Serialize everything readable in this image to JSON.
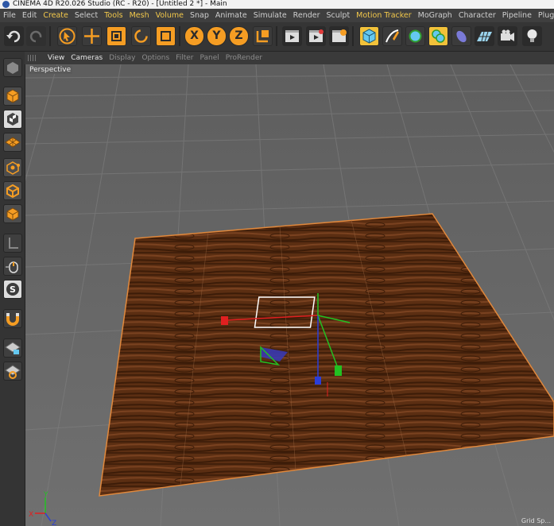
{
  "title_bar": {
    "text": "CINEMA 4D R20.026 Studio (RC - R20) - [Untitled 2 *] - Main"
  },
  "menu": {
    "items": [
      {
        "label": "File",
        "hl": false
      },
      {
        "label": "Edit",
        "hl": false
      },
      {
        "label": "Create",
        "hl": true
      },
      {
        "label": "Select",
        "hl": false
      },
      {
        "label": "Tools",
        "hl": true
      },
      {
        "label": "Mesh",
        "hl": true
      },
      {
        "label": "Volume",
        "hl": true
      },
      {
        "label": "Snap",
        "hl": false
      },
      {
        "label": "Animate",
        "hl": false
      },
      {
        "label": "Simulate",
        "hl": false
      },
      {
        "label": "Render",
        "hl": false
      },
      {
        "label": "Sculpt",
        "hl": false
      },
      {
        "label": "Motion Tracker",
        "hl": true
      },
      {
        "label": "MoGraph",
        "hl": false
      },
      {
        "label": "Character",
        "hl": false
      },
      {
        "label": "Pipeline",
        "hl": false
      },
      {
        "label": "Plugins",
        "hl": false
      }
    ]
  },
  "toolbar": {
    "x_label": "X",
    "y_label": "Y",
    "z_label": "Z",
    "buttons": [
      "undo",
      "redo",
      "select",
      "move",
      "scale",
      "rotate",
      "recent",
      "axis-x",
      "axis-y",
      "axis-z",
      "coordinate-system",
      "render-view",
      "render-picture-viewer",
      "render-settings",
      "cube",
      "pen",
      "subdivision",
      "array",
      "deformer",
      "floor",
      "camera",
      "light"
    ]
  },
  "viewport_menu": {
    "items": [
      {
        "label": "View",
        "on": true
      },
      {
        "label": "Cameras",
        "on": true
      },
      {
        "label": "Display",
        "on": false
      },
      {
        "label": "Options",
        "on": false
      },
      {
        "label": "Filter",
        "on": false
      },
      {
        "label": "Panel",
        "on": false
      },
      {
        "label": "ProRender",
        "on": false
      }
    ]
  },
  "viewport": {
    "camera_label": "Perspective",
    "grid_spacing_label": "Grid Sp...",
    "axis_labels": {
      "x": "X",
      "y": "Y",
      "z": "Z"
    }
  },
  "left_tools": [
    "make-editable",
    "model-mode",
    "texture-mode",
    "workplane",
    "points-mode",
    "edges-mode",
    "polygons-mode",
    "uv-mode",
    "enable-axis",
    "tweak",
    "solo",
    "snap",
    "lock-workplane",
    "workplane-grid"
  ],
  "colors": {
    "accent": "#f59d23",
    "selection": "#f2c23a",
    "x_axis": "#e02020",
    "y_axis": "#22c022",
    "z_axis": "#2a3ed8"
  }
}
